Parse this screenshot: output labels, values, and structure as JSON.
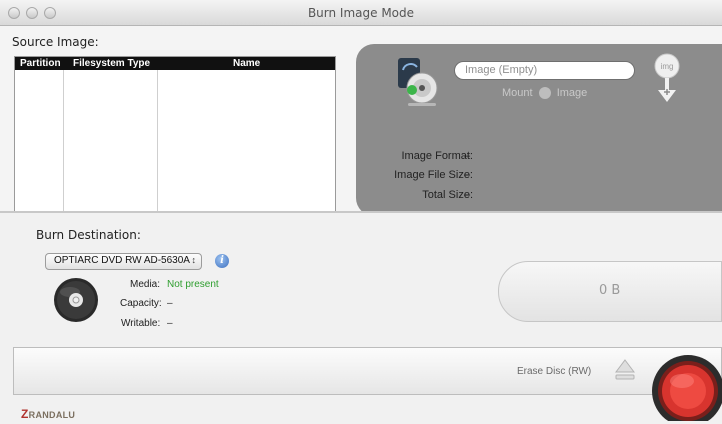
{
  "window": {
    "title": "Burn Image Mode"
  },
  "source": {
    "label": "Source Image:",
    "table": {
      "columns": [
        "Partition",
        "Filesystem Type",
        "Name"
      ],
      "rows": []
    }
  },
  "image": {
    "field_placeholder": "Image (Empty)",
    "mount_label": "Mount",
    "mount_suffix": "Image",
    "badge_text": "img",
    "info": [
      {
        "label": "Image Format:",
        "value": "–"
      },
      {
        "label": "Image File Size:",
        "value": "–"
      },
      {
        "label": "Total Size:",
        "value": "–"
      }
    ]
  },
  "destination": {
    "label": "Burn Destination:",
    "drive_selected": "OPTIARC DVD RW AD-5630A",
    "info_icon": "i",
    "media": [
      {
        "label": "Media:",
        "value": "Not present"
      },
      {
        "label": "Capacity:",
        "value": "–"
      },
      {
        "label": "Writable:",
        "value": "–"
      }
    ],
    "size_display": "0 B"
  },
  "burn_bar": {
    "erase_label": "Erase Disc (RW)"
  },
  "brand": {
    "logo_mark": "Z",
    "logo_rest": "RANDALU"
  },
  "colors": {
    "status_green": "#2f9e2f",
    "burn_red": "#e23b35",
    "panel_gray": "#8c8c8c"
  },
  "icons": [
    "drive-image-icon",
    "mount-icon",
    "img-badge-icon",
    "info-icon",
    "disc-icon",
    "eject-icon",
    "burn-button-icon"
  ]
}
